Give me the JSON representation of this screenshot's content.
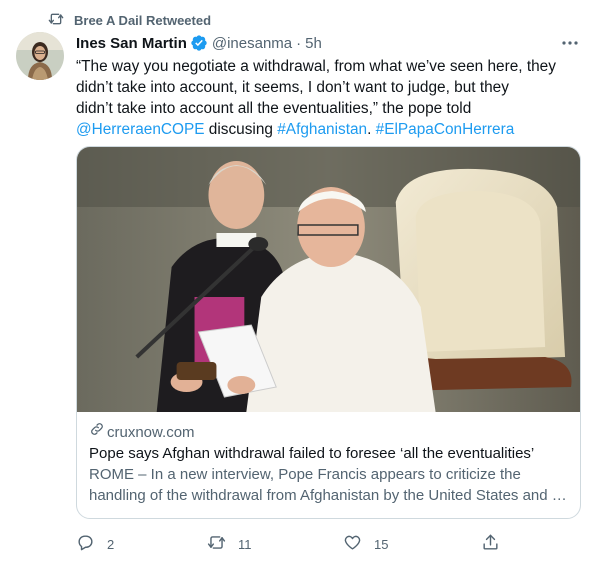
{
  "retweet": {
    "label": "Bree A Dail Retweeted"
  },
  "tweet": {
    "author_name": "Ines San Martin",
    "handle": "@inesanma",
    "separator": "·",
    "time": "5h",
    "text_line1": "“The way you negotiate a withdrawal, from what we’ve seen here, they",
    "text_line2": "didn’t take into account, it seems, I don’t want to judge, but they",
    "text_line3": "didn’t take into account all the eventualities,” the pope told",
    "mention": "@HerreraenCOPE",
    "text_mid": " discusing ",
    "hashtag1": "#Afghanistan",
    "text_dot": ". ",
    "hashtag2": "#ElPapaConHerrera"
  },
  "card": {
    "domain": "cruxnow.com",
    "title": "Pope says Afghan withdrawal failed to foresee ‘all the eventualities’",
    "desc_line1": "ROME – In a new interview, Pope Francis appears to criticize the",
    "desc_line2": "handling of the withdrawal from Afghanistan by the United States and its allies."
  },
  "actions": {
    "reply_count": "2",
    "retweet_count": "11",
    "like_count": "15"
  },
  "colors": {
    "accent": "#1d9bf0",
    "secondary_text": "#536471",
    "border": "#cfd9de"
  },
  "icons": [
    "retweet-icon",
    "verified-badge-icon",
    "more-options-icon",
    "link-icon",
    "reply-icon",
    "like-icon",
    "share-icon"
  ]
}
